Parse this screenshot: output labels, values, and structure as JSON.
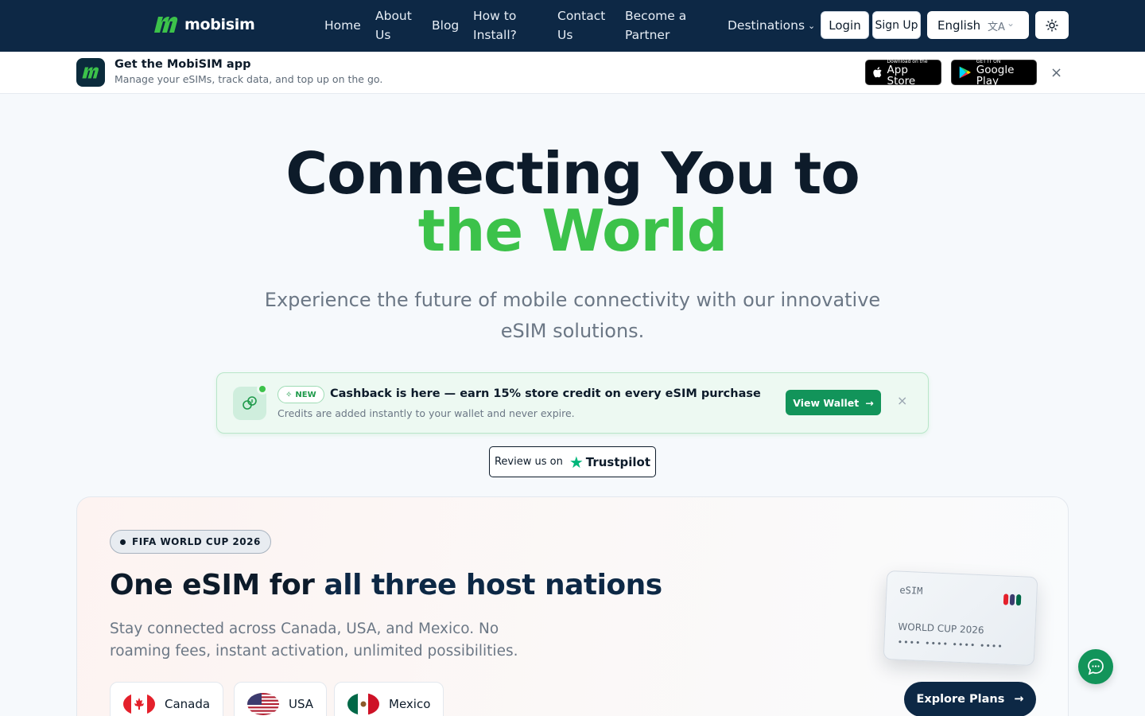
{
  "brand": {
    "name": "mobisim",
    "accent": "#3cc24a",
    "navy": "#0d2845"
  },
  "nav": {
    "links": [
      {
        "label_1": "Home",
        "label_2": ""
      },
      {
        "label_1": "About",
        "label_2": "Us"
      },
      {
        "label_1": "Blog",
        "label_2": ""
      },
      {
        "label_1": "How to",
        "label_2": "Install?"
      },
      {
        "label_1": "Contact",
        "label_2": "Us"
      },
      {
        "label_1": "Become a",
        "label_2": "Partner"
      }
    ],
    "destinations": "Destinations",
    "login": "Login",
    "signup": "Sign Up",
    "language": "English",
    "language_icon": "translate-icon",
    "theme_icon": "sun-icon"
  },
  "app_banner": {
    "title": "Get the MobiSIM app",
    "subtitle": "Manage your eSIMs, track data, and top up on the go.",
    "apple_small": "Download on the",
    "apple_big": "App Store",
    "google_small": "GET IT ON",
    "google_big": "Google Play",
    "close": "×"
  },
  "hero": {
    "line1": "Connecting You to",
    "line2": "the World",
    "subtitle": "Experience the future of mobile connectivity with our innovative eSIM solutions."
  },
  "cashback": {
    "badge": "NEW",
    "title": "Cashback is here — earn 15% store credit on every eSIM purchase",
    "subtitle": "Credits are added instantly to your wallet and never expire.",
    "button": "View Wallet",
    "close": "×"
  },
  "trustpilot": {
    "prefix": "Review us on",
    "brand": "Trustpilot"
  },
  "world_cup": {
    "badge": "FIFA WORLD CUP 2026",
    "title_plain": "One eSIM for ",
    "title_highlight": "all three host nations",
    "description": "Stay connected across Canada, USA, and Mexico. No roaming fees, instant activation, unlimited possibilities.",
    "countries": [
      "Canada",
      "USA",
      "Mexico"
    ],
    "card_label": "eSIM",
    "card_event": "WORLD CUP 2026",
    "card_number": "•••• •••• •••• ••••",
    "button": "Explore Plans"
  }
}
